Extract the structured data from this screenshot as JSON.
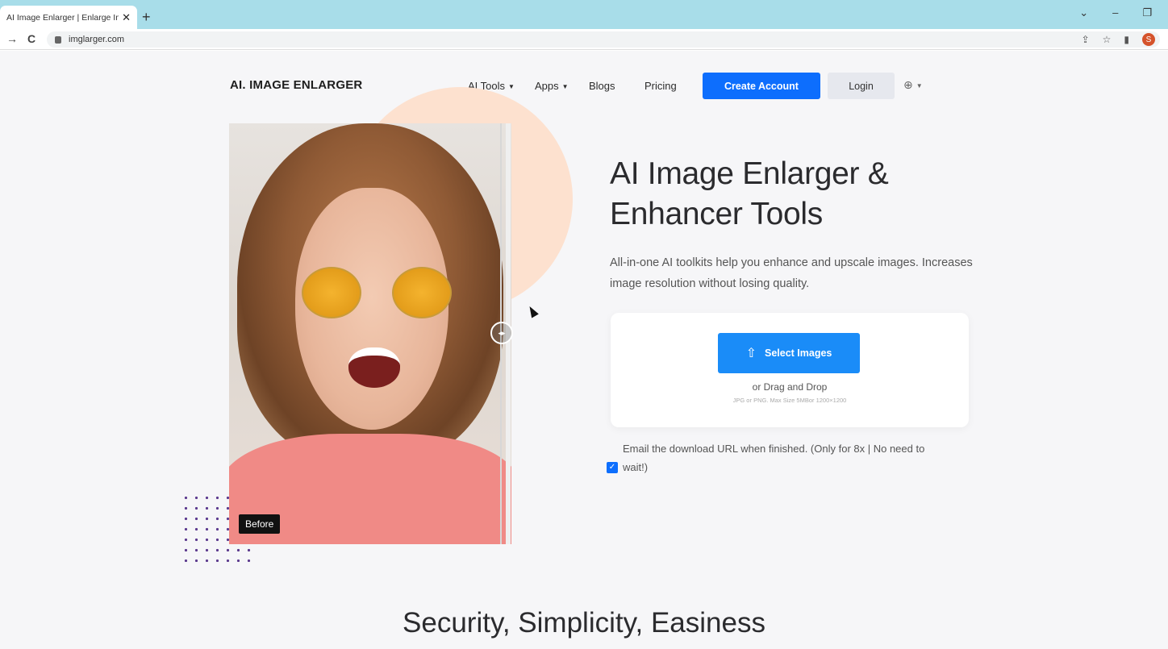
{
  "browser": {
    "tab_title": "AI Image Enlarger | Enlarge Imag",
    "tab_close": "✕",
    "new_tab": "+",
    "url": "imglarger.com",
    "back": "→",
    "reload": "C",
    "profile_initial": "S",
    "controls": {
      "dropdown": "⌄",
      "minimize": "–",
      "restore": "❐"
    }
  },
  "header": {
    "logo": "AI. IMAGE ENLARGER",
    "nav": {
      "ai_tools": "AI Tools",
      "apps": "Apps",
      "blogs": "Blogs",
      "pricing": "Pricing"
    },
    "create_account": "Create Account",
    "login": "Login"
  },
  "hero": {
    "title": "AI Image Enlarger & Enhancer Tools",
    "subtitle": "All-in-one AI toolkits help you enhance and upscale images. Increases image resolution without losing quality.",
    "before_label": "Before"
  },
  "upload": {
    "select_label": "Select Images",
    "drag_label": "or Drag and Drop",
    "hint": "JPG or PNG. Max Size 5MBor 1200×1200"
  },
  "email_option": {
    "line1": "Email the download URL when finished. (Only for 8x | No need to",
    "line2": "wait!)",
    "checked": true
  },
  "section": {
    "title": "Security, Simplicity, Easiness"
  },
  "colors": {
    "primary": "#0d6efd",
    "select_button": "#1a8cf8",
    "tabbar": "#a8dde9",
    "accent_circle": "#fde1cf"
  }
}
